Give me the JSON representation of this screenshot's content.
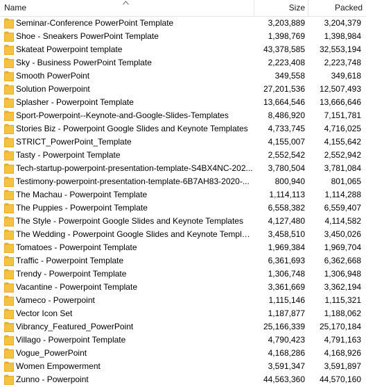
{
  "columns": {
    "name": "Name",
    "size": "Size",
    "packed": "Packed"
  },
  "colors": {
    "folder_fill": "#f5c342",
    "folder_tab": "#e8ab2a",
    "header_border": "#e5e5e5"
  },
  "rows": [
    {
      "name": "Seminar-Conference PowerPoint Template",
      "size": "3,203,889",
      "packed": "3,204,379"
    },
    {
      "name": "Shoe - Sneakers PowerPoint Template",
      "size": "1,398,769",
      "packed": "1,398,984"
    },
    {
      "name": "Skateat Powerpoint template",
      "size": "43,378,585",
      "packed": "32,553,194"
    },
    {
      "name": "Sky - Business PowerPoint Template",
      "size": "2,223,408",
      "packed": "2,223,748"
    },
    {
      "name": "Smooth PowerPoint",
      "size": "349,558",
      "packed": "349,618"
    },
    {
      "name": "Solution Powerpoint",
      "size": "27,201,536",
      "packed": "12,507,493"
    },
    {
      "name": "Splasher - Powerpoint Template",
      "size": "13,664,546",
      "packed": "13,666,646"
    },
    {
      "name": "Sport-Powerpoint--Keynote-and-Google-Slides-Templates",
      "size": "8,486,920",
      "packed": "7,151,781"
    },
    {
      "name": "Stories Biz - Powerpoint Google Slides and Keynote Templates",
      "size": "4,733,745",
      "packed": "4,716,025"
    },
    {
      "name": "STRICT_PowerPoint_Template",
      "size": "4,155,007",
      "packed": "4,155,642"
    },
    {
      "name": "Tasty - Powerpoint Template",
      "size": "2,552,542",
      "packed": "2,552,942"
    },
    {
      "name": "Tech-startup-powerpoint-presentation-template-S4BX4NC-202...",
      "size": "3,780,504",
      "packed": "3,781,084"
    },
    {
      "name": "Testimony-powerpoint-presentation-template-6B7AH83-2020-...",
      "size": "800,940",
      "packed": "801,065"
    },
    {
      "name": "The Machau - Powerpoint Template",
      "size": "1,114,113",
      "packed": "1,114,288"
    },
    {
      "name": "The Puppies - Powerpoint Template",
      "size": "6,558,382",
      "packed": "6,559,407"
    },
    {
      "name": "The Style - Powerpoint Google Slides and Keynote Templates",
      "size": "4,127,480",
      "packed": "4,114,582"
    },
    {
      "name": "The Wedding - Powerpoint Google Slides and Keynote Templates",
      "size": "3,458,510",
      "packed": "3,450,026"
    },
    {
      "name": "Tomatoes - Powerpoint Template",
      "size": "1,969,384",
      "packed": "1,969,704"
    },
    {
      "name": "Traffic - Powerpoint Template",
      "size": "6,361,693",
      "packed": "6,362,668"
    },
    {
      "name": "Trendy - Powerpoint Template",
      "size": "1,306,748",
      "packed": "1,306,948"
    },
    {
      "name": "Vacantine - Powerpoint Template",
      "size": "3,361,669",
      "packed": "3,362,194"
    },
    {
      "name": "Vameco - Powerpoint",
      "size": "1,115,146",
      "packed": "1,115,321"
    },
    {
      "name": "Vector Icon Set",
      "size": "1,187,877",
      "packed": "1,188,062"
    },
    {
      "name": "Vibrancy_Featured_PowerPoint",
      "size": "25,166,339",
      "packed": "25,170,184"
    },
    {
      "name": "Villago - Powerpoint Template",
      "size": "4,790,423",
      "packed": "4,791,163"
    },
    {
      "name": "Vogue_PowerPoint",
      "size": "4,168,286",
      "packed": "4,168,926"
    },
    {
      "name": "Women Empowerment",
      "size": "3,591,347",
      "packed": "3,591,897"
    },
    {
      "name": "Zunno - Powerpoint",
      "size": "44,563,360",
      "packed": "44,570,160"
    }
  ]
}
